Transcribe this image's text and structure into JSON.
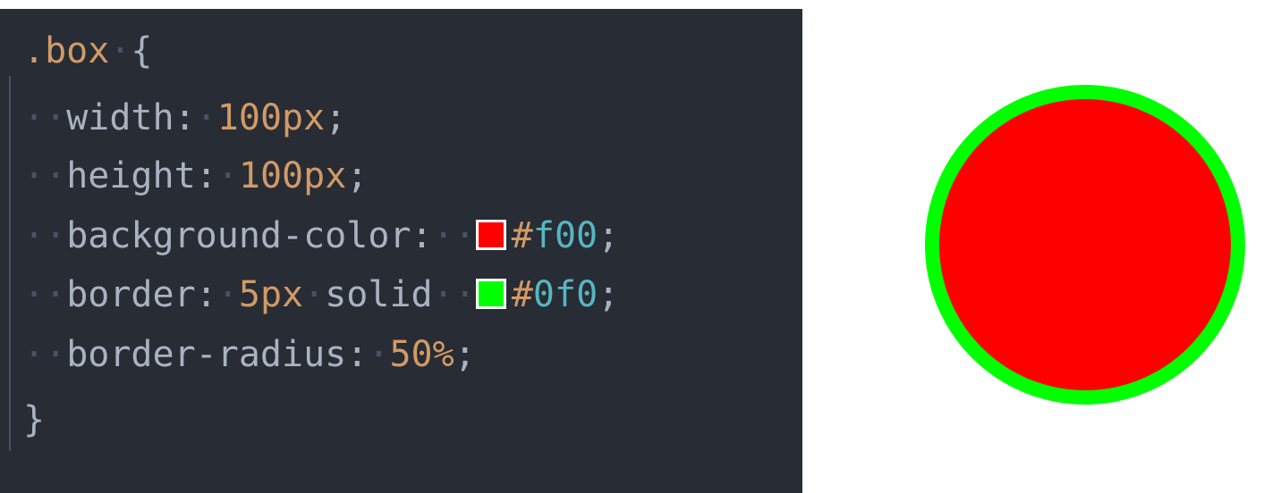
{
  "code": {
    "selector": ".box",
    "open_brace": "{",
    "close_brace": "}",
    "lines": [
      {
        "prop": "width:",
        "value": "100px",
        "semi": ";"
      },
      {
        "prop": "height:",
        "value": "100px",
        "semi": ";"
      },
      {
        "prop": "background-color:",
        "hash": "#",
        "hex": "f00",
        "semi": ";",
        "swatch_color": "#ff0000"
      },
      {
        "prop": "border:",
        "value": "5px",
        "keyword": "solid",
        "hash": "#",
        "hex": "0f0",
        "semi": ";",
        "swatch_color": "#00ff00"
      },
      {
        "prop": "border-radius:",
        "value": "50%",
        "semi": ";"
      }
    ],
    "whitespace_marker": "·"
  },
  "preview": {
    "fill_color": "#ff0000",
    "border_color": "#00ff00"
  },
  "theme": {
    "editor_bg": "#282c34",
    "number_color": "#d19a66",
    "hex_color": "#56b6c2",
    "text_color": "#abb2bf"
  }
}
